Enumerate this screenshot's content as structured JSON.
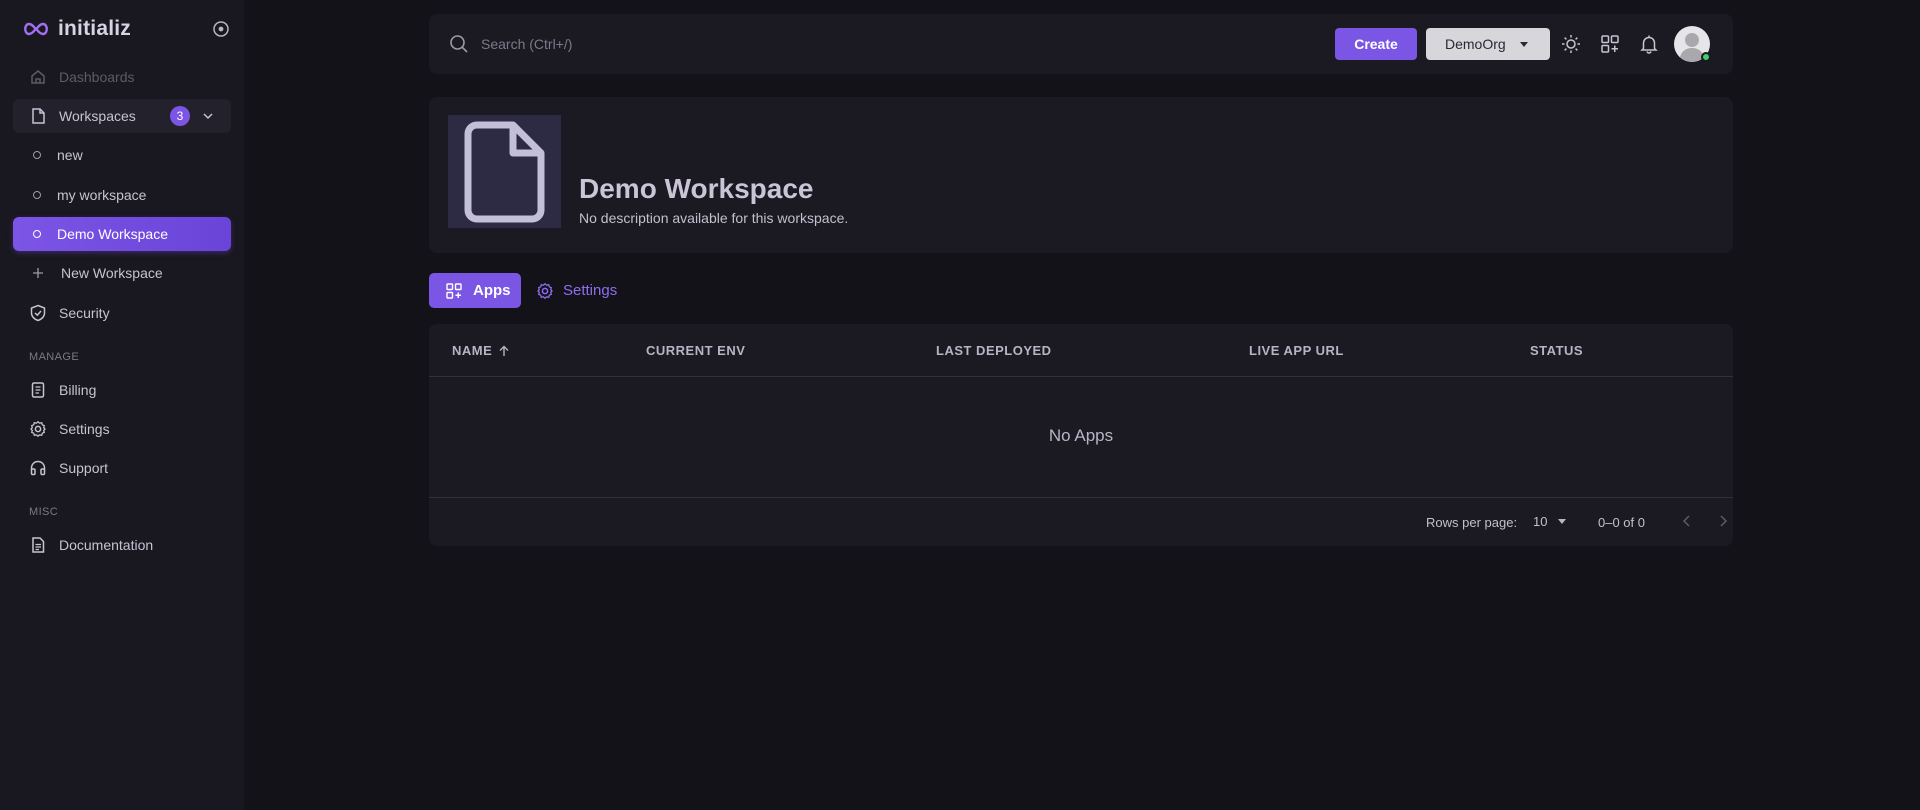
{
  "brand": {
    "name": "initializ"
  },
  "sidebar": {
    "dashboards": "Dashboards",
    "workspaces": {
      "label": "Workspaces",
      "count": "3"
    },
    "workspace_items": [
      {
        "label": "new"
      },
      {
        "label": "my workspace"
      },
      {
        "label": "Demo Workspace"
      }
    ],
    "new_workspace": "New Workspace",
    "security": "Security",
    "manage_label": "MANAGE",
    "billing": "Billing",
    "settings": "Settings",
    "support": "Support",
    "misc_label": "MISC",
    "documentation": "Documentation"
  },
  "topbar": {
    "search_placeholder": "Search (Ctrl+/)",
    "create_label": "Create",
    "org_label": "DemoOrg"
  },
  "workspace": {
    "title": "Demo Workspace",
    "description": "No description available for this workspace."
  },
  "tabs": {
    "apps": "Apps",
    "settings": "Settings"
  },
  "table": {
    "columns": [
      "NAME",
      "CURRENT ENV",
      "LAST DEPLOYED",
      "LIVE APP URL",
      "STATUS"
    ],
    "empty_message": "No Apps",
    "rows_per_page_label": "Rows per page:",
    "rows_per_page_value": "10",
    "range_label": "0–0 of 0"
  },
  "colors": {
    "accent": "#7b55e4",
    "background": "#141219",
    "sidebar": "#19171f",
    "card": "#1b1922",
    "online": "#3ecf6e"
  }
}
